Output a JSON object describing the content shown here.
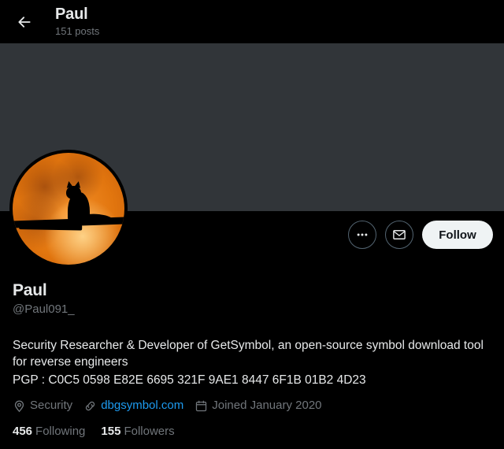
{
  "header": {
    "back_icon": "back-arrow-icon",
    "title": "Paul",
    "post_count": "151 posts"
  },
  "banner": {
    "color": "#313539"
  },
  "avatar": {
    "alt": "orange full moon with black cat silhouette on a branch",
    "moon_color": "#e2760f",
    "silhouette_color": "#000000"
  },
  "actions": {
    "more_icon": "ellipsis-icon",
    "message_icon": "envelope-icon",
    "follow_label": "Follow",
    "follow_bg": "#eff3f4",
    "follow_text_color": "#0f1419"
  },
  "profile": {
    "display_name": "Paul",
    "handle": "@Paul091_",
    "bio_line1": "Security Researcher & Developer of GetSymbol, an open-source symbol download tool for reverse engineers",
    "bio_line2": "PGP : C0C5 0598 E82E 6695 321F 9AE1 8447 6F1B 01B2 4D23"
  },
  "meta": {
    "location_icon": "location-pin-icon",
    "location": "Security",
    "link_icon": "link-icon",
    "website": "dbgsymbol.com",
    "website_color": "#1d9bf0",
    "calendar_icon": "calendar-icon",
    "joined": "Joined January 2020"
  },
  "stats": {
    "following_count": "456",
    "following_label": "Following",
    "followers_count": "155",
    "followers_label": "Followers"
  }
}
